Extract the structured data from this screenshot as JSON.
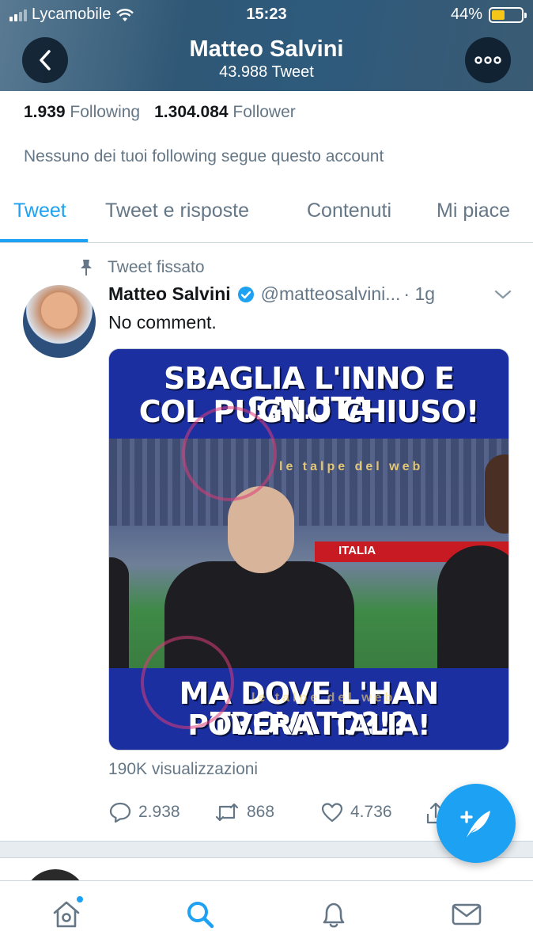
{
  "status_bar": {
    "carrier": "Lycamobile",
    "time": "15:23",
    "battery": "44%",
    "battery_level": 0.44
  },
  "header": {
    "title": "Matteo Salvini",
    "subtitle": "43.988 Tweet",
    "back_icon": "chevron-left-icon",
    "more_icon": "more-dots-icon"
  },
  "profile": {
    "following_count": "1.939",
    "following_label": "Following",
    "follower_count": "1.304.084",
    "follower_label": "Follower",
    "note": "Nessuno dei tuoi following segue questo account"
  },
  "tabs": [
    {
      "label": "Tweet",
      "active": true
    },
    {
      "label": "Tweet e risposte",
      "active": false
    },
    {
      "label": "Contenuti",
      "active": false
    },
    {
      "label": "Mi piace",
      "active": false
    }
  ],
  "tweet": {
    "pinned_label": "Tweet fissato",
    "author_name": "Matteo Salvini",
    "handle": "@matteosalvini...",
    "time": "· 1g",
    "text": "No comment.",
    "media": {
      "caption_top_line1": "SBAGLIA L'INNO E SALUTA",
      "caption_top_line2": "COL PUGNO CHIUSO!",
      "caption_bottom_line1": "MA DOVE L'HAN TROVATO?!?",
      "caption_bottom_line2": "POVERA ITALIA!",
      "billboard_text": "ITALIA",
      "watermark_text": "le talpe del web"
    },
    "views": "190K visualizzazioni",
    "replies": "2.938",
    "retweets": "868",
    "likes": "4.736"
  },
  "colors": {
    "accent": "#1da1f2",
    "muted": "#657786",
    "text": "#14171a",
    "header_bg": "#2f5876"
  },
  "bottom_nav": [
    "home-icon",
    "search-icon",
    "bell-icon",
    "mail-icon"
  ]
}
